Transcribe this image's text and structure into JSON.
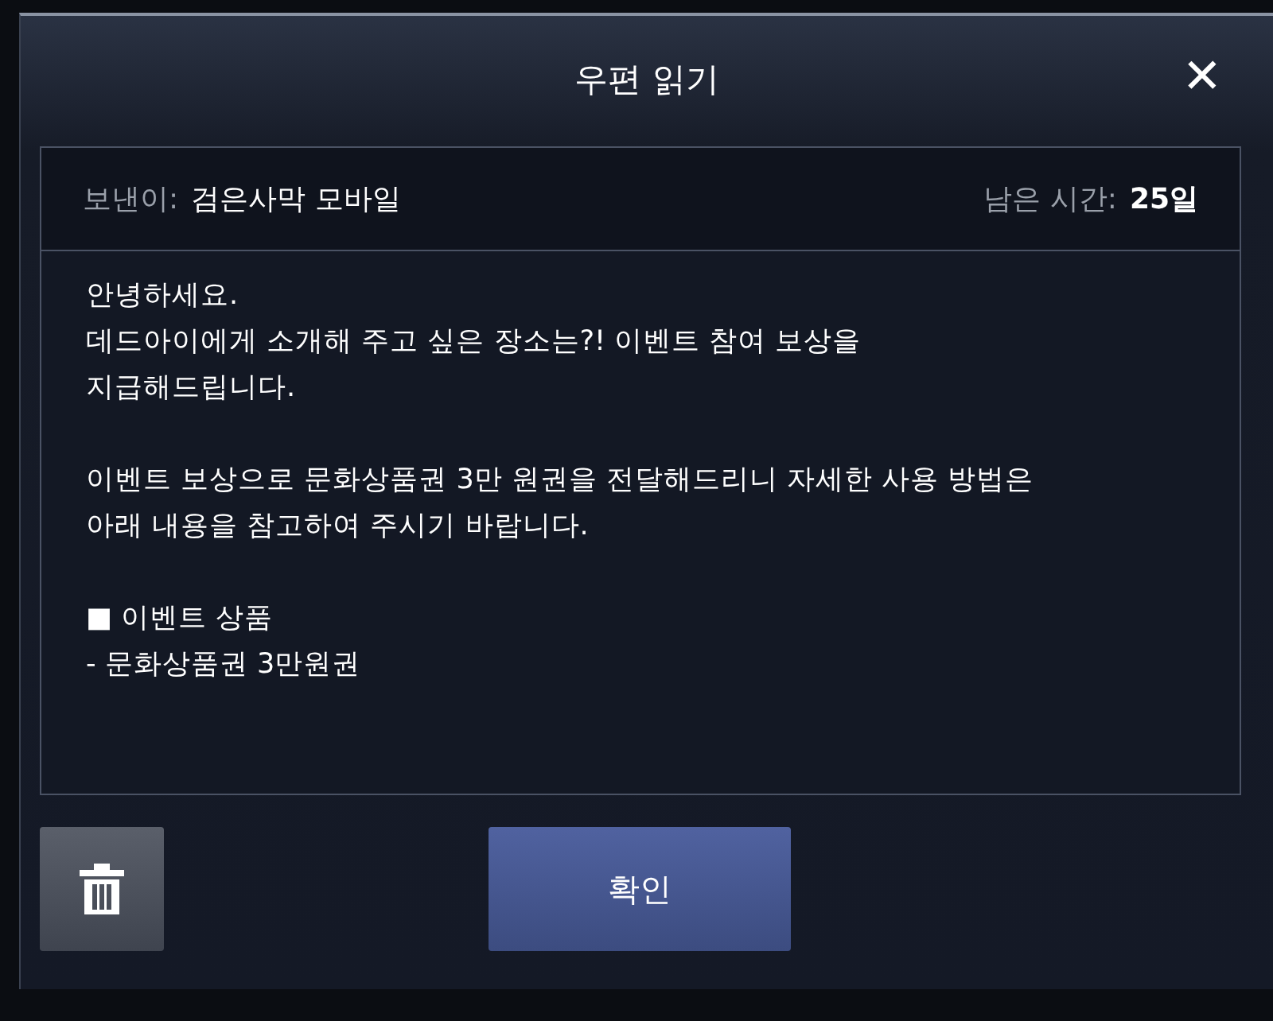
{
  "dialog": {
    "title": "우편 읽기",
    "close": "✕"
  },
  "info": {
    "sender_label": "보낸이:",
    "sender": "검은사막 모바일",
    "time_label": "남은 시간:",
    "time": "25일"
  },
  "body": [
    [
      "안녕하세요.",
      "데드아이에게 소개해 주고 싶은 장소는?! 이벤트 참여 보상을",
      "지급해드립니다."
    ],
    [
      "이벤트 보상으로 문화상품권 3만 원권을 전달해드리니 자세한 사용 방법은",
      "아래 내용을 참고하여 주시기 바랍니다."
    ],
    [
      "■ 이벤트 상품",
      "- 문화상품권 3만원권"
    ]
  ],
  "buttons": {
    "confirm": "확인"
  }
}
